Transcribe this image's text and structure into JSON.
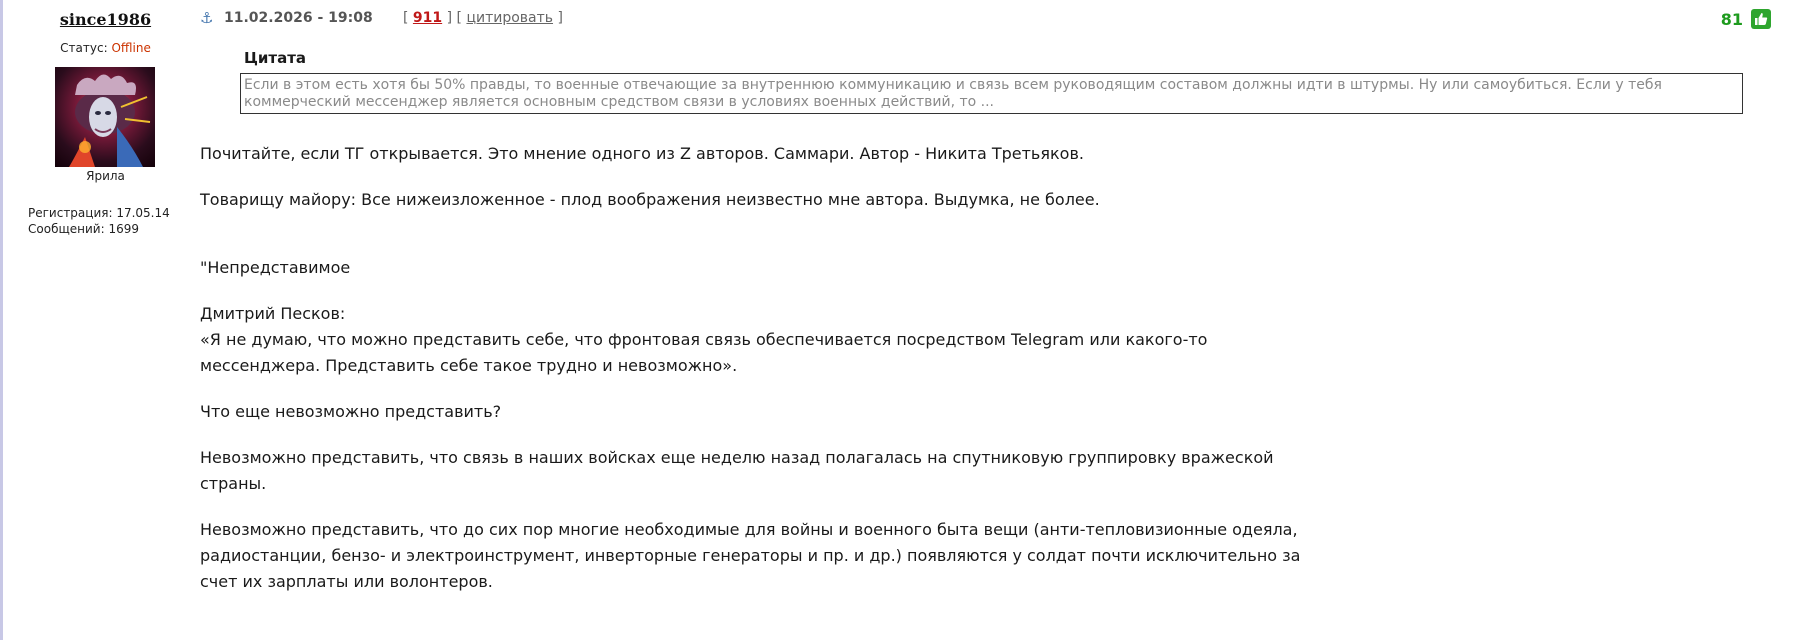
{
  "user": {
    "name": "since1986",
    "status_label": "Статус:",
    "status_value": "Offline",
    "avatar_caption": "Ярила",
    "registration": "Регистрация: 17.05.14",
    "messages": "Сообщений: 1699"
  },
  "post": {
    "date": "11.02.2026 - 19:08",
    "number": "911",
    "quote_action": "цитировать",
    "rating": "81",
    "quote": {
      "title": "Цитата",
      "text": "Если в этом есть хотя бы 50% правды, то военные отвечающие за внутреннюю коммуникацию и связь всем руководящим составом должны идти в штурмы. Ну или самоубиться. Если у тебя коммерческий мессенджер является основным средством связи в условиях военных действий, то ..."
    },
    "body": {
      "p1": "Почитайте, если ТГ открывается. Это мнение одного из Z авторов. Саммари. Автор - Никита Третьяков.",
      "p2": "Товарищу майору: Все нижеизложенное - плод воображения неизвестно мне автора. Выдумка, не более.",
      "p3": "\"Непредставимое",
      "p4": "Дмитрий Песков:",
      "p5": "«Я не думаю, что можно представить себе, что фронтовая связь обеспечивается посредством Telegram или какого-то мессенджера. Представить себе такое трудно и невозможно».",
      "p6": "Что еще невозможно представить?",
      "p7": "Невозможно представить, что связь в наших войсках еще неделю назад полагалась на спутниковую группировку вражеской страны.",
      "p8": "Невозможно представить, что до сих пор многие необходимые для войны и военного быта вещи (анти-тепловизионные одеяла, радиостанции, бензо- и электроинструмент, инверторные генераторы и пр. и др.) появляются у солдат почти исключительно за счет их зарплаты или волонтеров."
    }
  },
  "icons": {
    "anchor": "anchor-icon",
    "like": "thumbs-up-icon",
    "avatar": "avatar-image"
  },
  "colors": {
    "offline": "#cc3300",
    "post_number": "#c01818",
    "rating": "#1e9b1e",
    "like_bg": "#2ea52e"
  }
}
